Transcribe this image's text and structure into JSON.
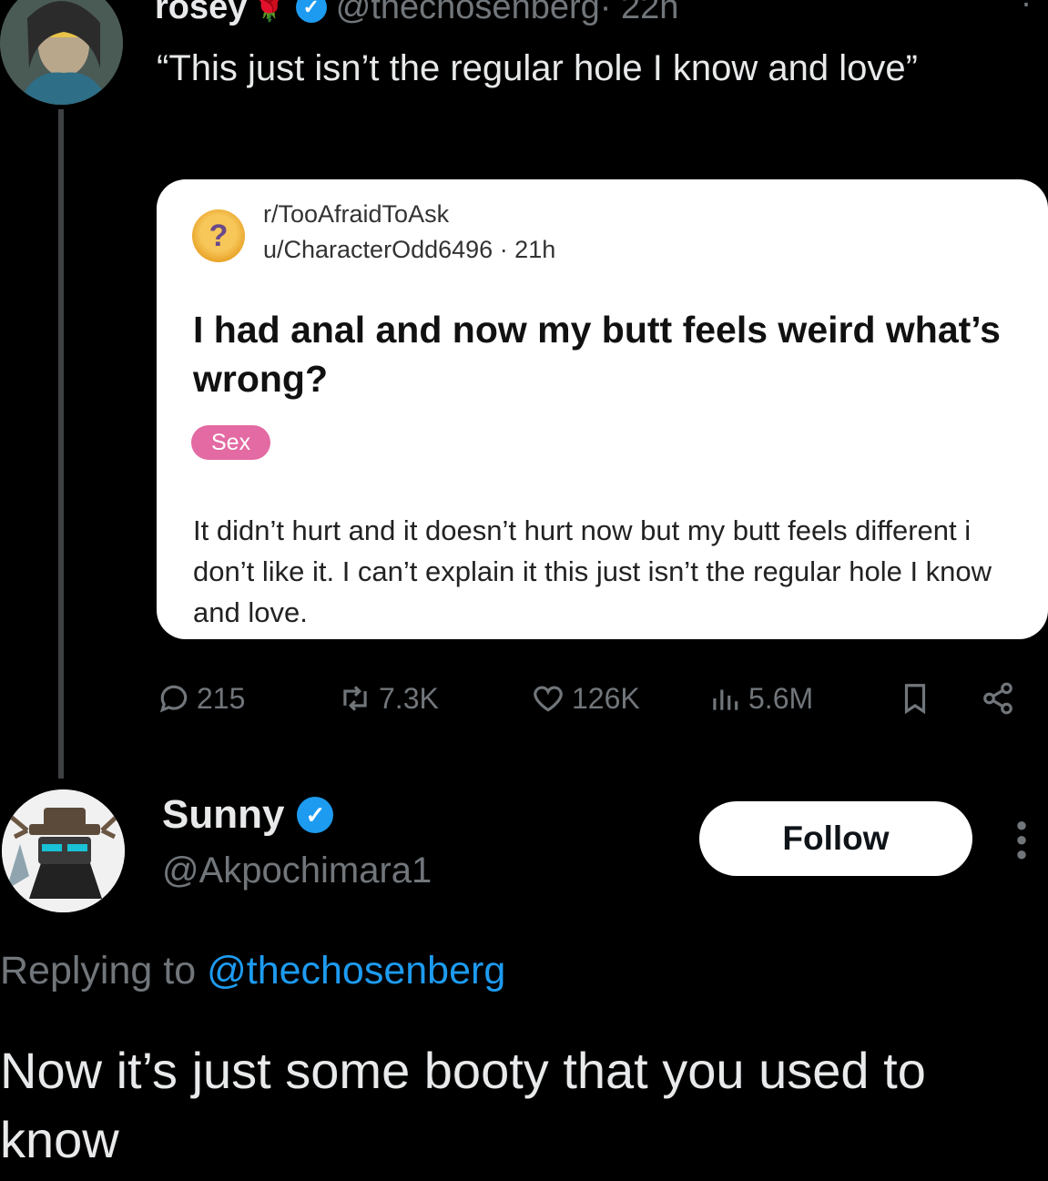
{
  "tweet": {
    "author_name": "rosey",
    "author_emoji": "🌹",
    "handle": "@thechosenberg",
    "time": "· 22h",
    "text": "“This just isn’t the regular hole I know and love”",
    "menu_icon": "more-vertical-icon"
  },
  "quoted_post": {
    "subreddit": "r/TooAfraidToAsk",
    "user": "u/CharacterOdd6496",
    "time": "· 21h",
    "icon_glyph": "?",
    "title": "I had anal and now my butt feels weird what’s wrong?",
    "flair": "Sex",
    "body": "It didn’t hurt and it doesn’t hurt now but my butt feels different i don’t like it. I can’t explain it this just isn’t the regular hole I know and love."
  },
  "actions": {
    "replies": "215",
    "retweets": "7.3K",
    "likes": "126K",
    "views": "5.6M"
  },
  "reply": {
    "author_name": "Sunny",
    "handle": "@Akpochimara1",
    "follow_label": "Follow",
    "replying_prefix": "Replying to",
    "replying_mention": "@thechosenberg",
    "text": "Now it’s just some booty that you used to know"
  },
  "colors": {
    "background": "#000000",
    "verified_blue": "#1d9bf0",
    "muted_text": "#71767b",
    "flair_pink": "#e36aa2"
  }
}
